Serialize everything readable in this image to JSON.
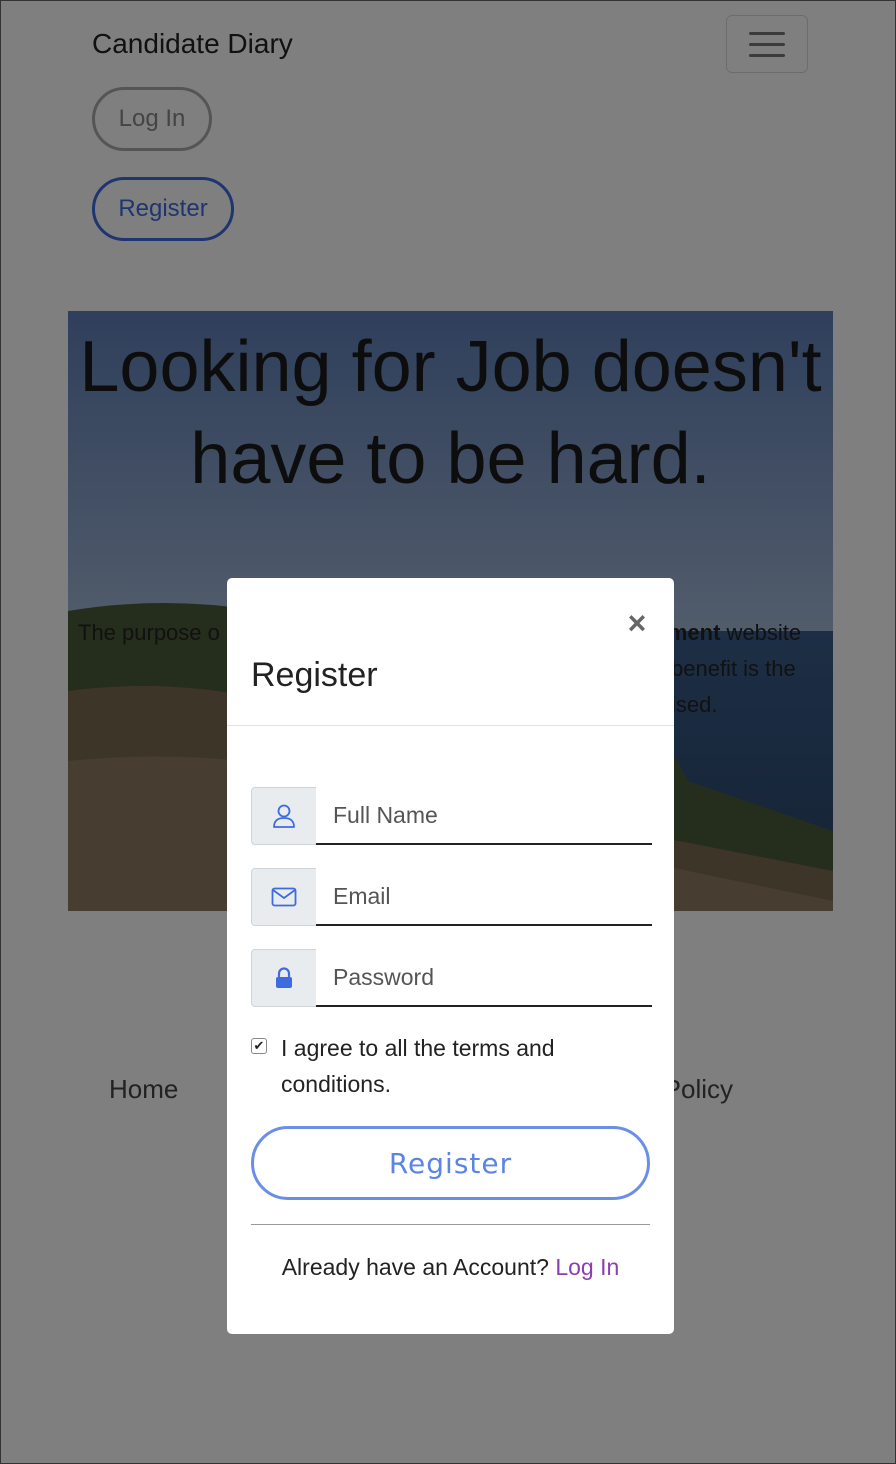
{
  "navbar": {
    "brand": "Candidate Diary",
    "login_label": "Log In",
    "register_label": "Register"
  },
  "hero": {
    "title": "Looking for Job doesn't have to be hard.",
    "text_visible_start": "The purpose o",
    "text_bold": "ment",
    "text_line1_end": " website",
    "text_line2_end": "benefit is the",
    "text_line3_end": "ised."
  },
  "footer": {
    "home": "Home",
    "privacy": "acy Policy"
  },
  "modal": {
    "close": "×",
    "title": "Register",
    "fields": [
      {
        "placeholder": "Full Name",
        "icon": "user-icon"
      },
      {
        "placeholder": "Email",
        "icon": "envelope-icon"
      },
      {
        "placeholder": "Password",
        "icon": "lock-icon"
      }
    ],
    "terms_checked": true,
    "terms_label": "I agree to all the terms and conditions.",
    "submit_label": "Register",
    "already_text": "Already have an Account?",
    "login_link": "Log In"
  },
  "colors": {
    "accent": "#3f6be0",
    "link": "#8a3fb0",
    "icon": "#3f6be0"
  }
}
